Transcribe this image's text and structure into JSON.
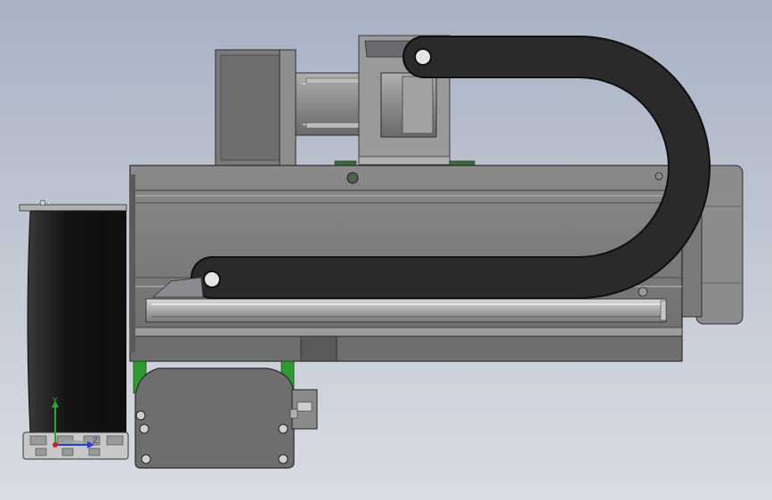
{
  "viewport": {
    "background_top": "#a8b2c4",
    "background_bottom": "#d9dce3"
  },
  "triad": {
    "y_label": "Y",
    "z_label": "Z",
    "y_color": "#2fa52f",
    "z_color": "#2b3bd6",
    "x_color": "#d02020"
  },
  "colors": {
    "housing": "#7c7c7c",
    "housing_dark": "#5e5e5e",
    "cable_chain": "#262626",
    "motor_body": "#8e8e8e",
    "green_mount": "#2f9a2f"
  }
}
